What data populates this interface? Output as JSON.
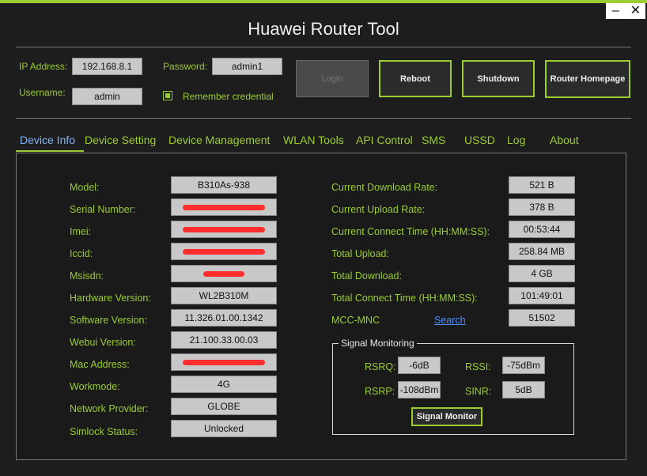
{
  "window": {
    "title": "Huawei Router Tool",
    "minimize": "–",
    "close": "✕"
  },
  "login": {
    "ip_label": "IP Address:",
    "ip_value": "192.168.8.1",
    "password_label": "Password:",
    "password_value": "admin1",
    "username_label": "Username:",
    "username_value": "admin",
    "remember_label": "Remember credential",
    "remember_checked": true
  },
  "buttons": {
    "login": "Login",
    "reboot": "Reboot",
    "shutdown": "Shutdown",
    "homepage": "Router Homepage"
  },
  "tabs": [
    "Device Info",
    "Device Setting",
    "Device Management",
    "WLAN Tools",
    "API Control",
    "SMS",
    "USSD",
    "Log",
    "About"
  ],
  "device_info": {
    "model_label": "Model:",
    "model": "B310As-938",
    "serial_label": "Serial Number:",
    "imei_label": "Imei:",
    "iccid_label": "Iccid:",
    "msisdn_label": "Msisdn:",
    "hardware_label": "Hardware Version:",
    "hardware": "WL2B310M",
    "software_label": "Software Version:",
    "software": "11.326.01.00.1342",
    "webui_label": "Webui Version:",
    "webui": "21.100.33.00.03",
    "mac_label": "Mac Address:",
    "workmode_label": "Workmode:",
    "workmode": "4G",
    "provider_label": "Network Provider:",
    "provider": "GLOBE",
    "simlock_label": "Simlock Status:",
    "simlock": "Unlocked"
  },
  "stats": {
    "download_rate_label": "Current Download Rate:",
    "download_rate": "521 B",
    "upload_rate_label": "Current Upload Rate:",
    "upload_rate": "378 B",
    "connect_time_label": "Current Connect Time (HH:MM:SS):",
    "connect_time": "00:53:44",
    "total_upload_label": "Total Upload:",
    "total_upload": "258.84 MB",
    "total_download_label": "Total Download:",
    "total_download": "4 GB",
    "total_connect_label": "Total Connect Time (HH:MM:SS):",
    "total_connect": "101:49:01",
    "mcc_label": "MCC-MNC",
    "mcc_search": "Search",
    "mcc_value": "51502"
  },
  "signal": {
    "group_title": "Signal Monitoring",
    "rsrq_label": "RSRQ:",
    "rsrq": "-6dB",
    "rssi_label": "RSSI:",
    "rssi": "-75dBm",
    "rsrp_label": "RSRP:",
    "rsrp": "-108dBm",
    "sinr_label": "SINR:",
    "sinr": "5dB",
    "monitor_button": "Signal Monitor"
  },
  "colors": {
    "accent": "#9acd32",
    "active_tab": "#7fb3ff",
    "redaction": "#ff2d2d"
  }
}
